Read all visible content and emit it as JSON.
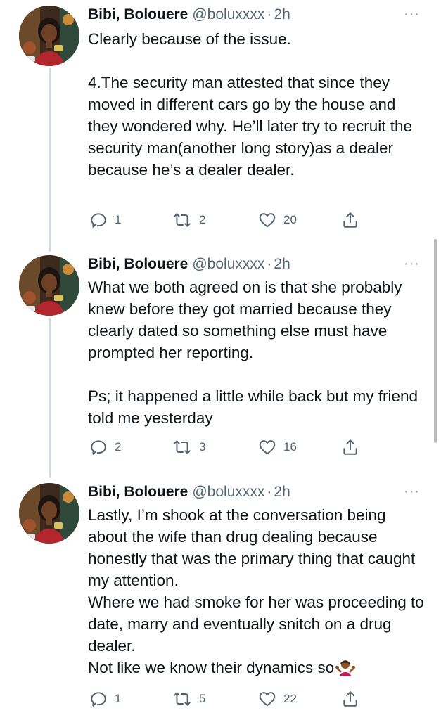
{
  "tweets": [
    {
      "name": "Bibi, Bolouere",
      "handle": "@boluxxxx",
      "separator": "·",
      "time": "2h",
      "text": "Clearly because of the issue.\n\n4.The security man attested that since they moved in different cars go by the house and they wondered why. He’ll later try to recruit the security man(another long story)as a dealer because he’s a dealer dealer.",
      "replies": "1",
      "retweets": "2",
      "likes": "20"
    },
    {
      "name": "Bibi, Bolouere",
      "handle": "@boluxxxx",
      "separator": "·",
      "time": "2h",
      "text": "What we both agreed on is that she probably knew before they got married because they clearly dated so something else must have prompted her reporting.\n\nPs; it happened a little while back but my friend told me yesterday",
      "replies": "2",
      "retweets": "3",
      "likes": "16"
    },
    {
      "name": "Bibi, Bolouere",
      "handle": "@boluxxxx",
      "separator": "·",
      "time": "2h",
      "text": "Lastly, I’m shook at the conversation being about the wife than drug dealing because honestly that was the primary thing that caught my attention.\nWhere we had smoke for her was proceeding to date, marry and eventually snitch on a drug dealer.\nNot like we know their dynamics so",
      "emoji": "woman-shrugging-emoji",
      "replies": "1",
      "retweets": "5",
      "likes": "22"
    }
  ],
  "icons": {
    "reply": "reply-icon",
    "retweet": "retweet-icon",
    "like": "heart-icon",
    "share": "share-icon",
    "more": "more-icon"
  },
  "more_glyph": "···",
  "colors": {
    "text": "#0f1419",
    "secondary": "#536471",
    "thread_line": "#cfd9de",
    "background": "#ffffff"
  }
}
